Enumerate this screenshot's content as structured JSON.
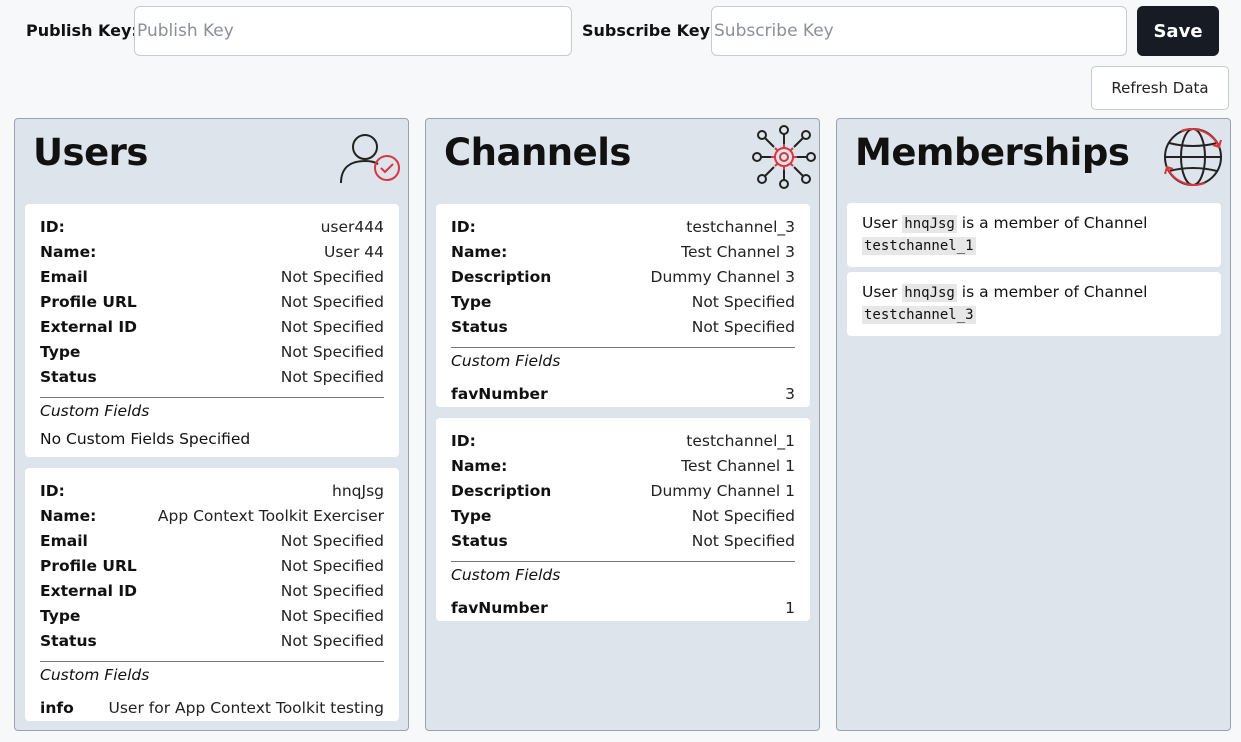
{
  "header": {
    "publish_label": "Publish Key:",
    "publish_placeholder": "Publish Key",
    "publish_value": "",
    "subscribe_label": "Subscribe Key:",
    "subscribe_placeholder": "Subscribe Key",
    "subscribe_value": "",
    "save_label": "Save",
    "refresh_label": "Refresh Data"
  },
  "users": {
    "title": "Users",
    "icon": "user-check-icon",
    "cards": [
      {
        "fields": [
          {
            "key": "ID:",
            "value": "user444"
          },
          {
            "key": "Name:",
            "value": "User 44"
          },
          {
            "key": "Email",
            "value": "Not Specified"
          },
          {
            "key": "Profile URL",
            "value": "Not Specified"
          },
          {
            "key": "External ID",
            "value": "Not Specified"
          },
          {
            "key": "Type",
            "value": "Not Specified"
          },
          {
            "key": "Status",
            "value": "Not Specified"
          }
        ],
        "custom_title": "Custom Fields",
        "custom_none": "No Custom Fields Specified"
      },
      {
        "fields": [
          {
            "key": "ID:",
            "value": "hnqJsg"
          },
          {
            "key": "Name:",
            "value": "App Context Toolkit Exerciser"
          },
          {
            "key": "Email",
            "value": "Not Specified"
          },
          {
            "key": "Profile URL",
            "value": "Not Specified"
          },
          {
            "key": "External ID",
            "value": "Not Specified"
          },
          {
            "key": "Type",
            "value": "Not Specified"
          },
          {
            "key": "Status",
            "value": "Not Specified"
          }
        ],
        "custom_title": "Custom Fields",
        "custom_fields": [
          {
            "key": "info",
            "value": "User for App Context Toolkit testing"
          }
        ]
      }
    ]
  },
  "channels": {
    "title": "Channels",
    "icon": "network-gear-icon",
    "cards": [
      {
        "fields": [
          {
            "key": "ID:",
            "value": "testchannel_3"
          },
          {
            "key": "Name:",
            "value": "Test Channel 3"
          },
          {
            "key": "Description",
            "value": "Dummy Channel 3"
          },
          {
            "key": "Type",
            "value": "Not Specified"
          },
          {
            "key": "Status",
            "value": "Not Specified"
          }
        ],
        "custom_title": "Custom Fields",
        "custom_fields": [
          {
            "key": "favNumber",
            "value": "3"
          }
        ]
      },
      {
        "fields": [
          {
            "key": "ID:",
            "value": "testchannel_1"
          },
          {
            "key": "Name:",
            "value": "Test Channel 1"
          },
          {
            "key": "Description",
            "value": "Dummy Channel 1"
          },
          {
            "key": "Type",
            "value": "Not Specified"
          },
          {
            "key": "Status",
            "value": "Not Specified"
          }
        ],
        "custom_title": "Custom Fields",
        "custom_fields": [
          {
            "key": "favNumber",
            "value": "1"
          }
        ]
      }
    ]
  },
  "memberships": {
    "title": "Memberships",
    "icon": "globe-sync-icon",
    "prefix": "User",
    "middle": "is a member of Channel",
    "items": [
      {
        "user": "hnqJsg",
        "channel": "testchannel_1"
      },
      {
        "user": "hnqJsg",
        "channel": "testchannel_3"
      }
    ]
  },
  "colors": {
    "accent": "#d9363e",
    "panel_bg": "#dde4ec",
    "save_bg": "#161b24"
  }
}
